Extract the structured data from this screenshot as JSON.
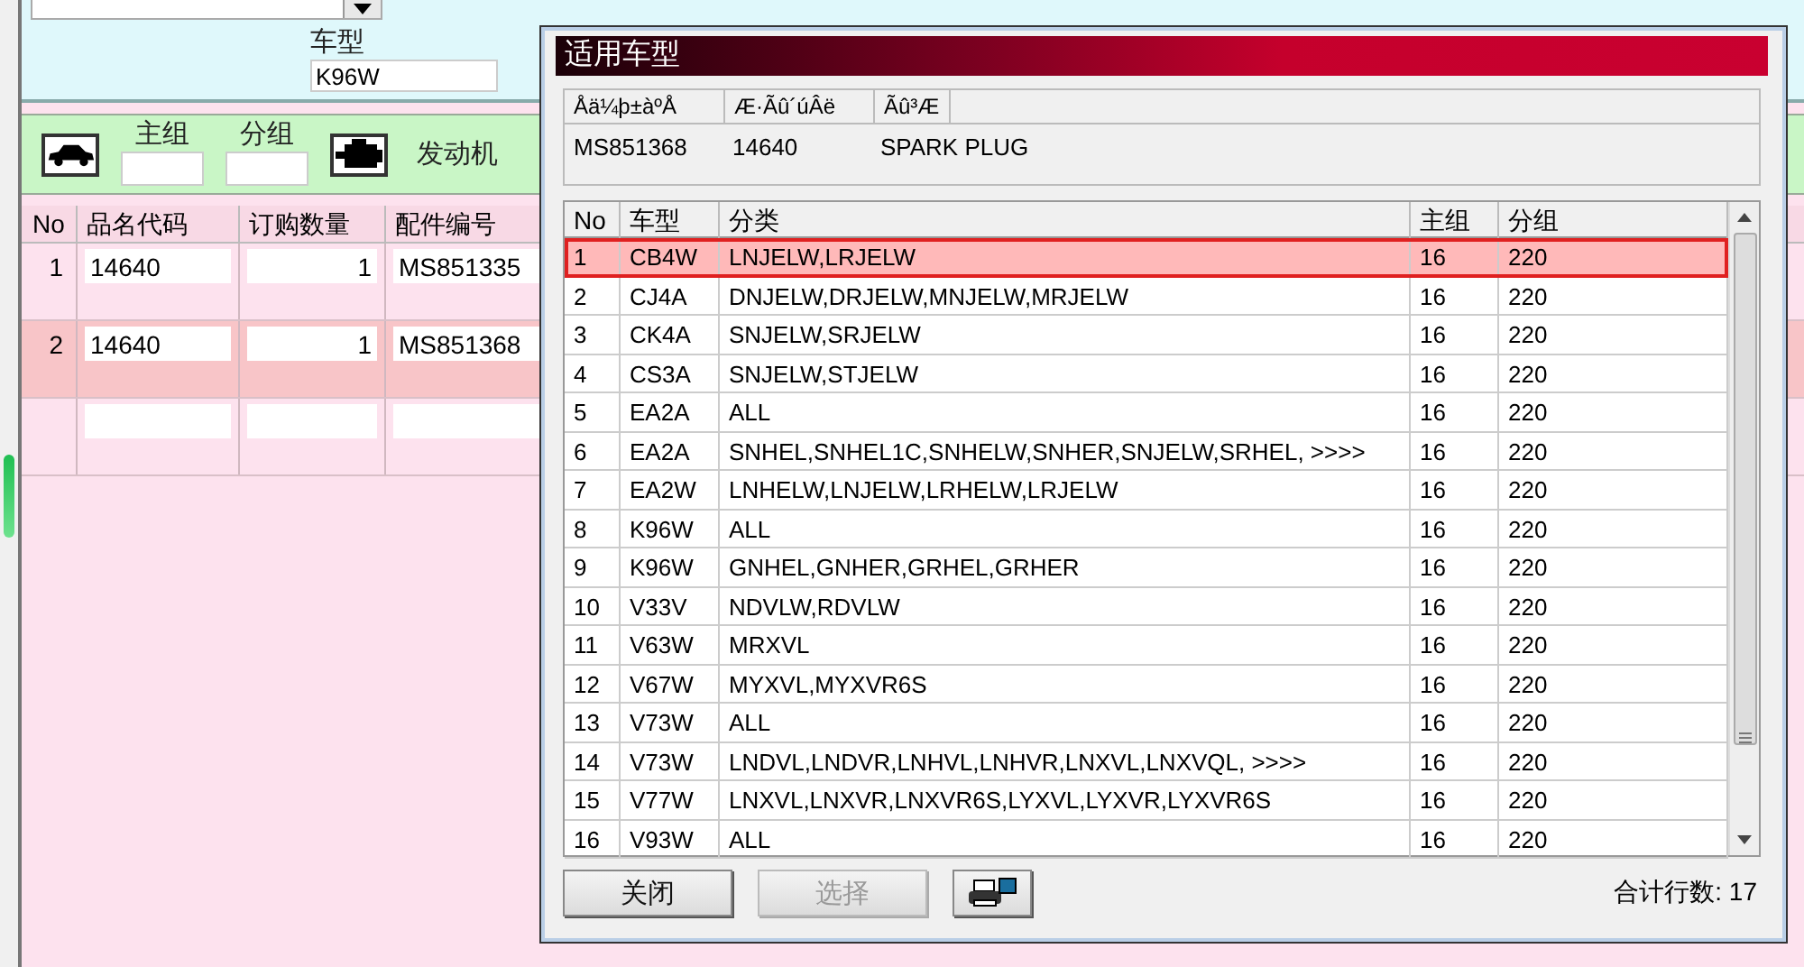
{
  "main_form": {
    "vehicle_model_label": "车型",
    "vehicle_model_value": "K96W",
    "main_group_label": "主组",
    "sub_group_label": "分组",
    "engine_label": "发动机"
  },
  "order_table": {
    "columns": [
      "No",
      "品名代码",
      "订购数量",
      "配件编号"
    ],
    "rows": [
      {
        "no": "1",
        "code": "14640",
        "qty": "1",
        "part": "MS851335",
        "selected": false
      },
      {
        "no": "2",
        "code": "14640",
        "qty": "1",
        "part": "MS851368",
        "selected": true
      }
    ]
  },
  "dialog": {
    "title": "适用车型",
    "info_columns": [
      "Åä¼þ±àºÅ",
      "Æ·Ãû´úÂë",
      "Ãû³Æ"
    ],
    "info_values": [
      "MS851368",
      "14640",
      "SPARK PLUG"
    ],
    "columns": [
      "No",
      "车型",
      "分类",
      "主组",
      "分组"
    ],
    "rows": [
      {
        "no": "1",
        "model": "CB4W",
        "category": "LNJELW,LRJELW",
        "main_group": "16",
        "sub_group": "220",
        "selected": true
      },
      {
        "no": "2",
        "model": "CJ4A",
        "category": "DNJELW,DRJELW,MNJELW,MRJELW",
        "main_group": "16",
        "sub_group": "220",
        "selected": false
      },
      {
        "no": "3",
        "model": "CK4A",
        "category": "SNJELW,SRJELW",
        "main_group": "16",
        "sub_group": "220",
        "selected": false
      },
      {
        "no": "4",
        "model": "CS3A",
        "category": "SNJELW,STJELW",
        "main_group": "16",
        "sub_group": "220",
        "selected": false
      },
      {
        "no": "5",
        "model": "EA2A",
        "category": "ALL",
        "main_group": "16",
        "sub_group": "220",
        "selected": false
      },
      {
        "no": "6",
        "model": "EA2A",
        "category": "SNHEL,SNHEL1C,SNHELW,SNHER,SNJELW,SRHEL,  >>>>",
        "main_group": "16",
        "sub_group": "220",
        "selected": false
      },
      {
        "no": "7",
        "model": "EA2W",
        "category": "LNHELW,LNJELW,LRHELW,LRJELW",
        "main_group": "16",
        "sub_group": "220",
        "selected": false
      },
      {
        "no": "8",
        "model": "K96W",
        "category": "ALL",
        "main_group": "16",
        "sub_group": "220",
        "selected": false
      },
      {
        "no": "9",
        "model": "K96W",
        "category": "GNHEL,GNHER,GRHEL,GRHER",
        "main_group": "16",
        "sub_group": "220",
        "selected": false
      },
      {
        "no": "10",
        "model": "V33V",
        "category": "NDVLW,RDVLW",
        "main_group": "16",
        "sub_group": "220",
        "selected": false
      },
      {
        "no": "11",
        "model": "V63W",
        "category": "MRXVL",
        "main_group": "16",
        "sub_group": "220",
        "selected": false
      },
      {
        "no": "12",
        "model": "V67W",
        "category": "MYXVL,MYXVR6S",
        "main_group": "16",
        "sub_group": "220",
        "selected": false
      },
      {
        "no": "13",
        "model": "V73W",
        "category": "ALL",
        "main_group": "16",
        "sub_group": "220",
        "selected": false
      },
      {
        "no": "14",
        "model": "V73W",
        "category": "LNDVL,LNDVR,LNHVL,LNHVR,LNXVL,LNXVQL,  >>>>",
        "main_group": "16",
        "sub_group": "220",
        "selected": false
      },
      {
        "no": "15",
        "model": "V77W",
        "category": "LNXVL,LNXVR,LNXVR6S,LYXVL,LYXVR,LYXVR6S",
        "main_group": "16",
        "sub_group": "220",
        "selected": false
      },
      {
        "no": "16",
        "model": "V93W",
        "category": "ALL",
        "main_group": "16",
        "sub_group": "220",
        "selected": false
      }
    ],
    "buttons": [
      {
        "kind": "text",
        "label": "关闭",
        "disabled": false
      },
      {
        "kind": "text",
        "label": "选择",
        "disabled": true
      },
      {
        "kind": "print"
      }
    ],
    "total": "合计行数: 17"
  }
}
